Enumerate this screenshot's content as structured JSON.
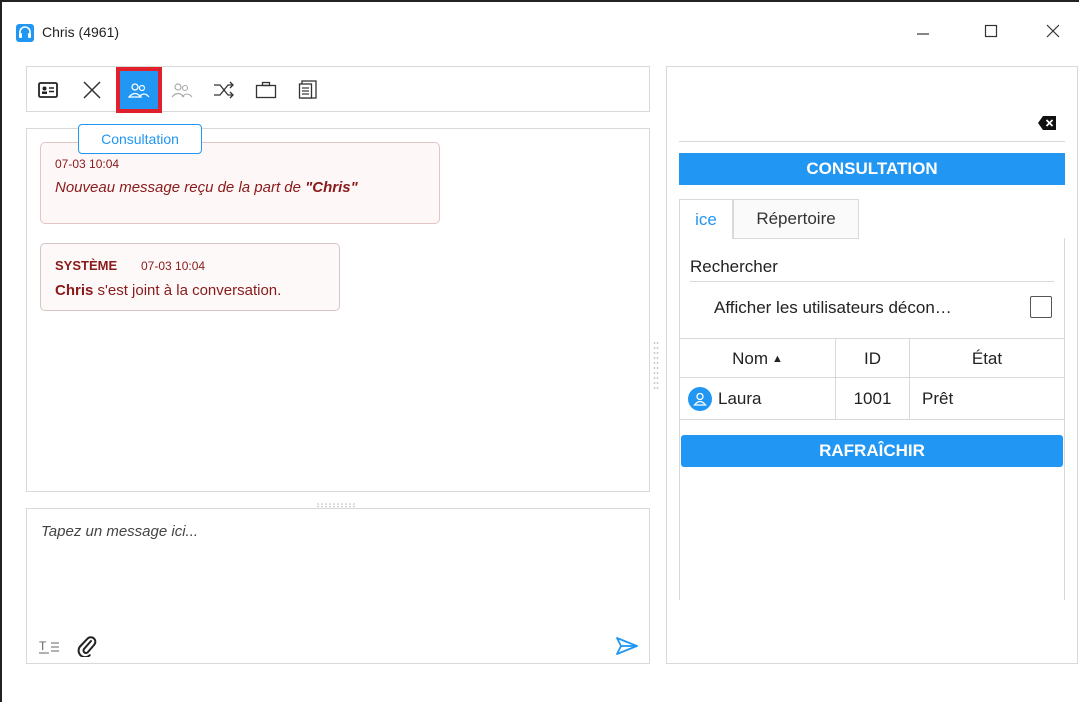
{
  "window": {
    "title": "Chris (4961)"
  },
  "toolbar": {
    "icons": [
      "contact-card-icon",
      "end-call-icon",
      "consultation-icon",
      "conference-icon",
      "transfer-icon",
      "briefcase-icon",
      "notes-icon"
    ],
    "tooltip": "Consultation"
  },
  "chat": {
    "messages": [
      {
        "timestamp": "07-03 10:04",
        "text_before": "Nouveau message reçu de la part de ",
        "text_bold": "\"Chris\""
      },
      {
        "sender": "SYSTÈME",
        "timestamp": "07-03 10:04",
        "name": "Chris",
        "text": " s'est joint à la conversation."
      }
    ],
    "input_placeholder": "Tapez un message ici..."
  },
  "consultation": {
    "header": "CONSULTATION",
    "tabs": [
      {
        "label": "ice",
        "active": true
      },
      {
        "label": "Répertoire",
        "active": false
      }
    ],
    "search_placeholder": "Rechercher",
    "show_offline_label": "Afficher les utilisateurs décon…",
    "columns": {
      "name": "Nom",
      "id": "ID",
      "state": "État"
    },
    "rows": [
      {
        "name": "Laura",
        "id": "1001",
        "state": "Prêt"
      }
    ],
    "refresh_label": "RAFRAÎCHIR"
  },
  "colors": {
    "accent": "#2196f3",
    "highlight": "#e0202a",
    "message_text": "#8a1a1a"
  }
}
